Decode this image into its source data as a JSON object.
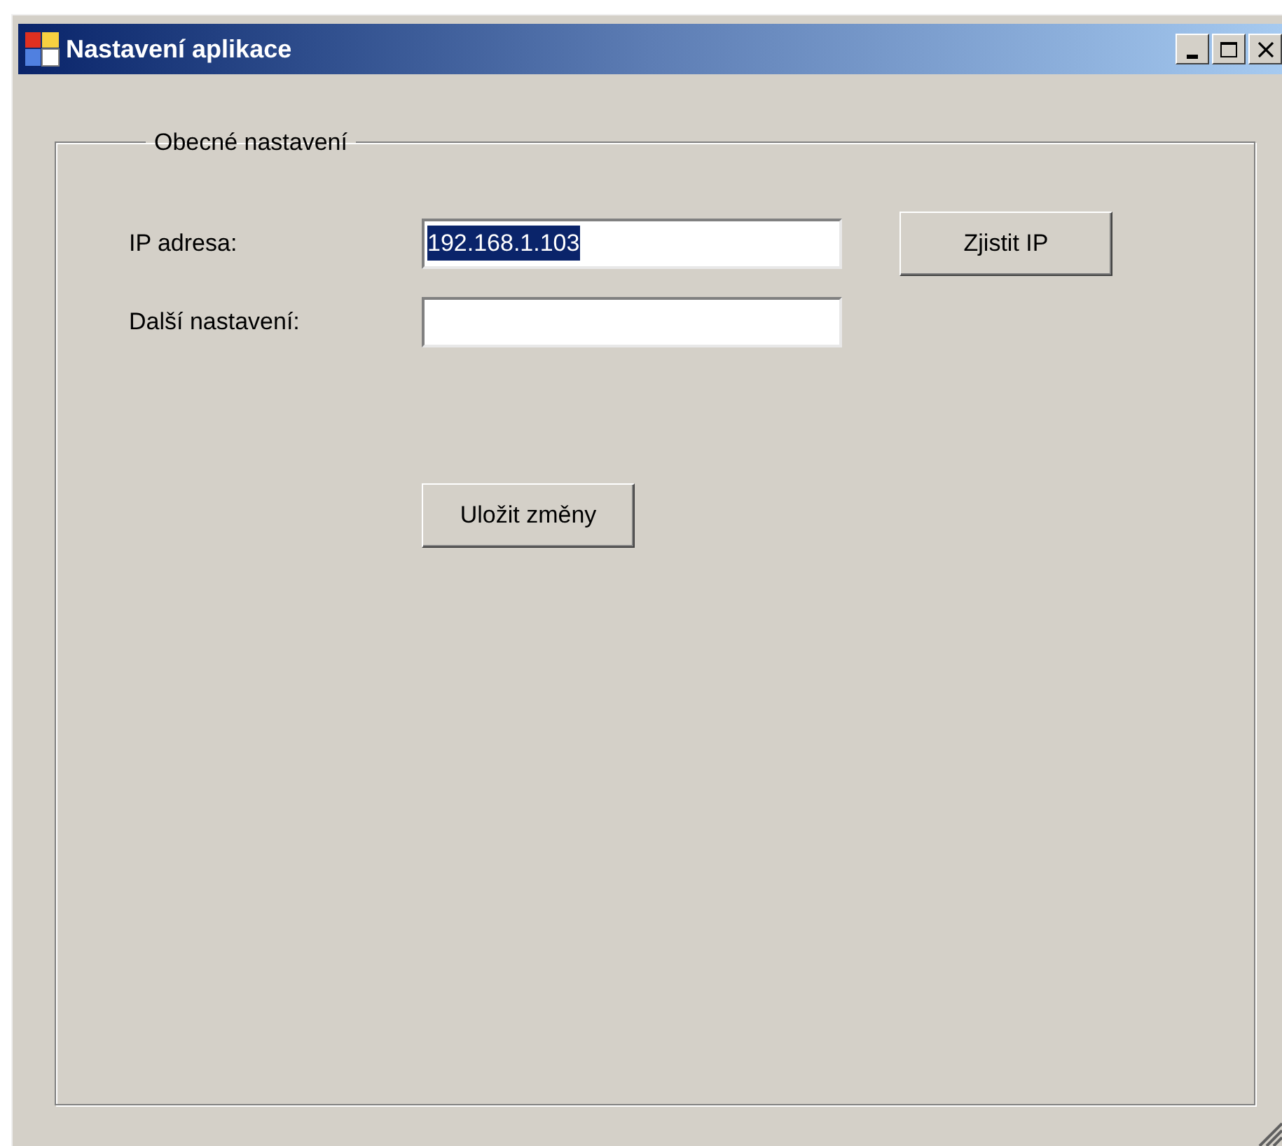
{
  "window": {
    "title": "Nastavení aplikace"
  },
  "group": {
    "title": "Obecné nastavení",
    "fields": [
      {
        "label": "IP adresa:",
        "value": "192.168.1.103",
        "text_selected": true,
        "button": "Zjistit IP"
      },
      {
        "label": "Další nastavení:"
      }
    ],
    "save_button": "Uložit změny"
  }
}
